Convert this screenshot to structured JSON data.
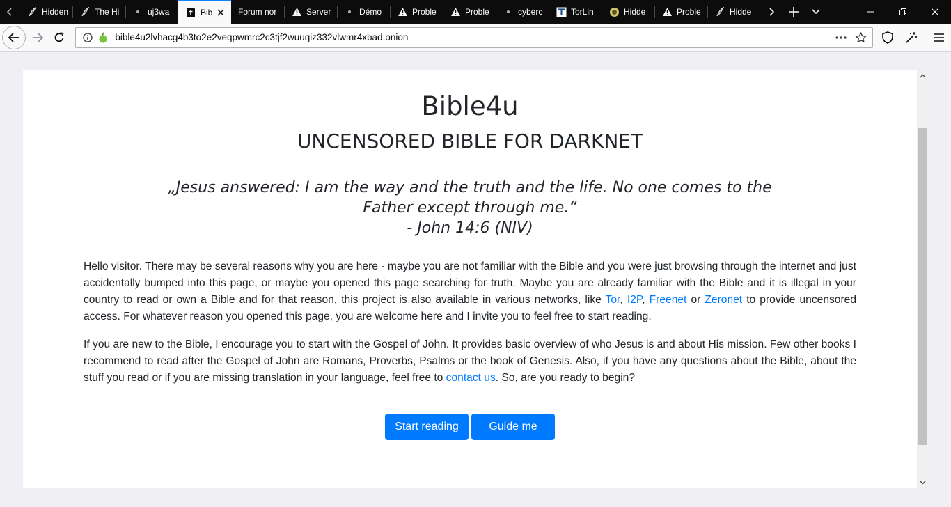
{
  "tabs": [
    {
      "title": "Hidden",
      "icon": "feather-icon"
    },
    {
      "title": "The Hi",
      "icon": "feather-icon"
    },
    {
      "title": "uj3wa",
      "icon": "dot-icon"
    },
    {
      "title": "Bib",
      "icon": "bible-icon",
      "active": true
    },
    {
      "title": "Forum nor",
      "icon": "none"
    },
    {
      "title": "Server",
      "icon": "warning-icon"
    },
    {
      "title": "Démo",
      "icon": "dot-icon"
    },
    {
      "title": "Proble",
      "icon": "warning-icon"
    },
    {
      "title": "Proble",
      "icon": "warning-icon"
    },
    {
      "title": "cyberc",
      "icon": "dot-icon"
    },
    {
      "title": "TorLin",
      "icon": "t-icon"
    },
    {
      "title": "Hidde",
      "icon": "circle-icon"
    },
    {
      "title": "Proble",
      "icon": "warning-icon"
    },
    {
      "title": "Hidde",
      "icon": "feather-icon"
    }
  ],
  "url": "bible4u2lvhacg4b3to2e2veqpwmrc2c3tjf2wuuqiz332vlwmr4xbad.onion",
  "page": {
    "title": "Bible4u",
    "subtitle": "UNCENSORED BIBLE FOR DARKNET",
    "quote_text": "„Jesus answered: I am the way and the truth and the life. No one comes to the Father except through me.“",
    "quote_ref": "- John 14:6 (NIV)",
    "p1_a": "Hello visitor. There may be several reasons why you are here - maybe you are not familiar with the Bible and you were just browsing through the internet and just accidentally bumped into this page, or maybe you opened this page searching for truth. Maybe you are already familiar with the Bible and it is illegal in your country to read or own a Bible and for that reason, this project is also available in various networks, like ",
    "link_tor": "Tor",
    "sep1": ", ",
    "link_i2p": "I2P",
    "sep2": ", ",
    "link_freenet": "Freenet",
    "sep3": " or ",
    "link_zeronet": "Zeronet",
    "p1_b": " to provide uncensored access. For whatever reason you opened this page, you are welcome here and I invite you to feel free to start reading.",
    "p2_a": "If you are new to the Bible, I encourage you to start with the Gospel of John. It provides basic overview of who Jesus is and about His mission. Few other books I recommend to read after the Gospel of John are Romans, Proverbs, Psalms or the book of Genesis. Also, if you have any questions about the Bible, about the stuff you read or if you are missing translation in your language, feel free to ",
    "link_contact": "contact us",
    "p2_b": ". So, are you ready to begin?",
    "btn_start": "Start reading",
    "btn_guide": "Guide me"
  },
  "colors": {
    "accent": "#0a84ff",
    "button": "#007bff",
    "link": "#007bff"
  }
}
